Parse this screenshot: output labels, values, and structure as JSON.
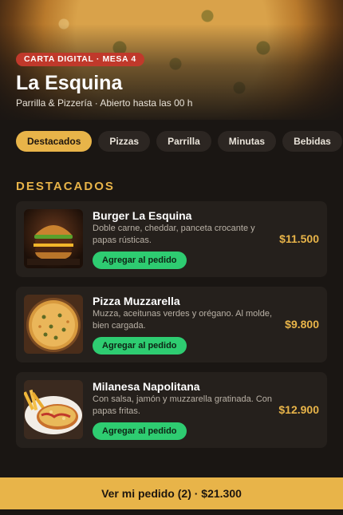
{
  "header": {
    "badge": "CARTA DIGITAL · MESA 4",
    "title": "La Esquina",
    "subtitle": "Parrilla & Pizzería · Abierto hasta las 00 h"
  },
  "tabs": [
    "Destacados",
    "Pizzas",
    "Parrilla",
    "Minutas",
    "Bebidas"
  ],
  "active_tab": "Destacados",
  "section_title": "DESTACADOS",
  "items": [
    {
      "name": "Burger La Esquina",
      "description": "Doble carne, cheddar, panceta crocante y papas rústicas.",
      "price": "$11.500",
      "action": "Agregar al pedido",
      "image_icon": "burger-image"
    },
    {
      "name": "Pizza Muzzarella",
      "description": "Muzza, aceitunas verdes y orégano. Al molde, bien cargada.",
      "price": "$9.800",
      "action": "Agregar al pedido",
      "image_icon": "pizza-image"
    },
    {
      "name": "Milanesa Napolitana",
      "description": "Con salsa, jamón y muzzarella gratinada. Con papas fritas.",
      "price": "$12.900",
      "action": "Agregar al pedido",
      "image_icon": "milanesa-image"
    }
  ],
  "footer": {
    "label": "Ver mi pedido (2) · $21.300"
  },
  "colors": {
    "accent": "#e8b449",
    "add_button": "#2ecc71",
    "badge": "#c0392b",
    "background": "#1a1613"
  }
}
